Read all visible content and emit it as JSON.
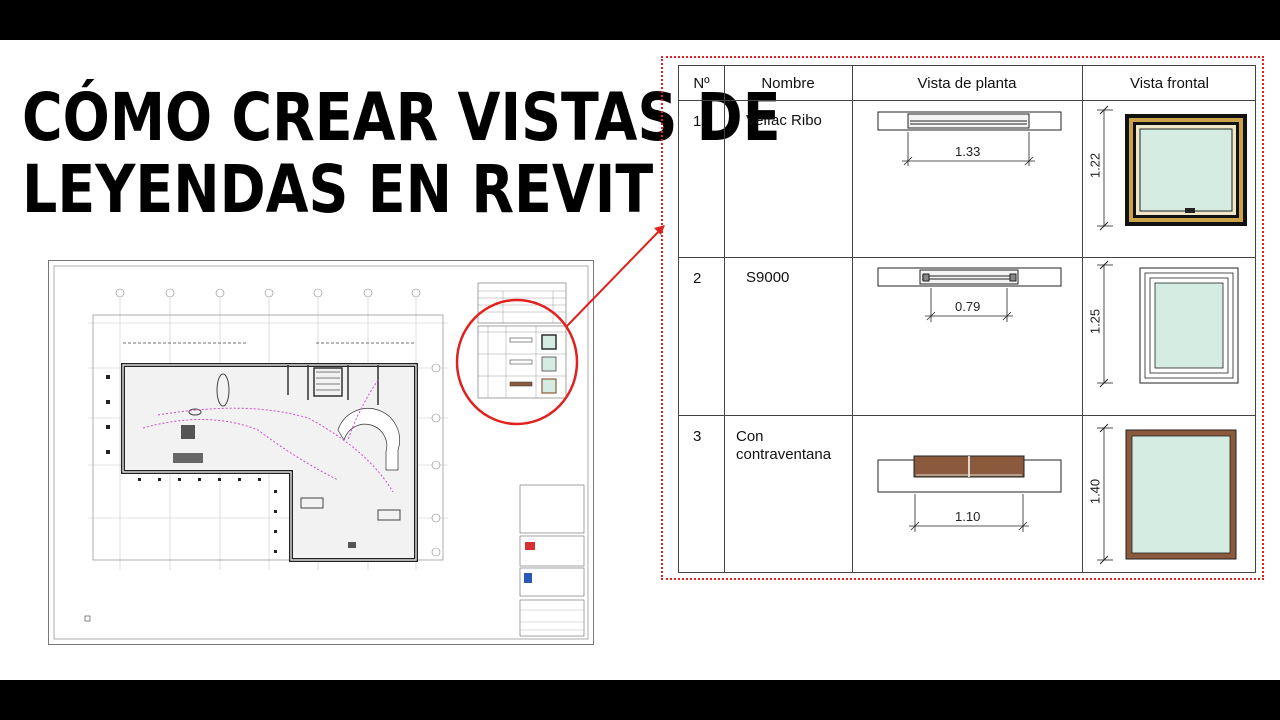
{
  "title": {
    "line1": "CÓMO CREAR VISTAS DE",
    "line2": "LEYENDAS EN REVIT"
  },
  "legend": {
    "headers": [
      "Nº",
      "Nombre",
      "Vista de planta",
      "Vista frontal"
    ],
    "rows": [
      {
        "num": "1",
        "name": "Velfac Ribo",
        "plan_dim": "1.33",
        "height_dim": "1.22"
      },
      {
        "num": "2",
        "name": "S9000",
        "plan_dim": "0.79",
        "height_dim": "1.25"
      },
      {
        "num": "3",
        "name": "Con contraventana",
        "plan_dim": "1.10",
        "height_dim": "1.40"
      }
    ]
  },
  "colors": {
    "highlight": "#e0211d",
    "glass": "#d5ece3",
    "wood": "#8b5a3c",
    "frame_gold": "#c9a24a",
    "text": "#111111"
  },
  "icons": [
    "floor-plan-thumbnail",
    "zoom-circle",
    "connector-arrow"
  ]
}
